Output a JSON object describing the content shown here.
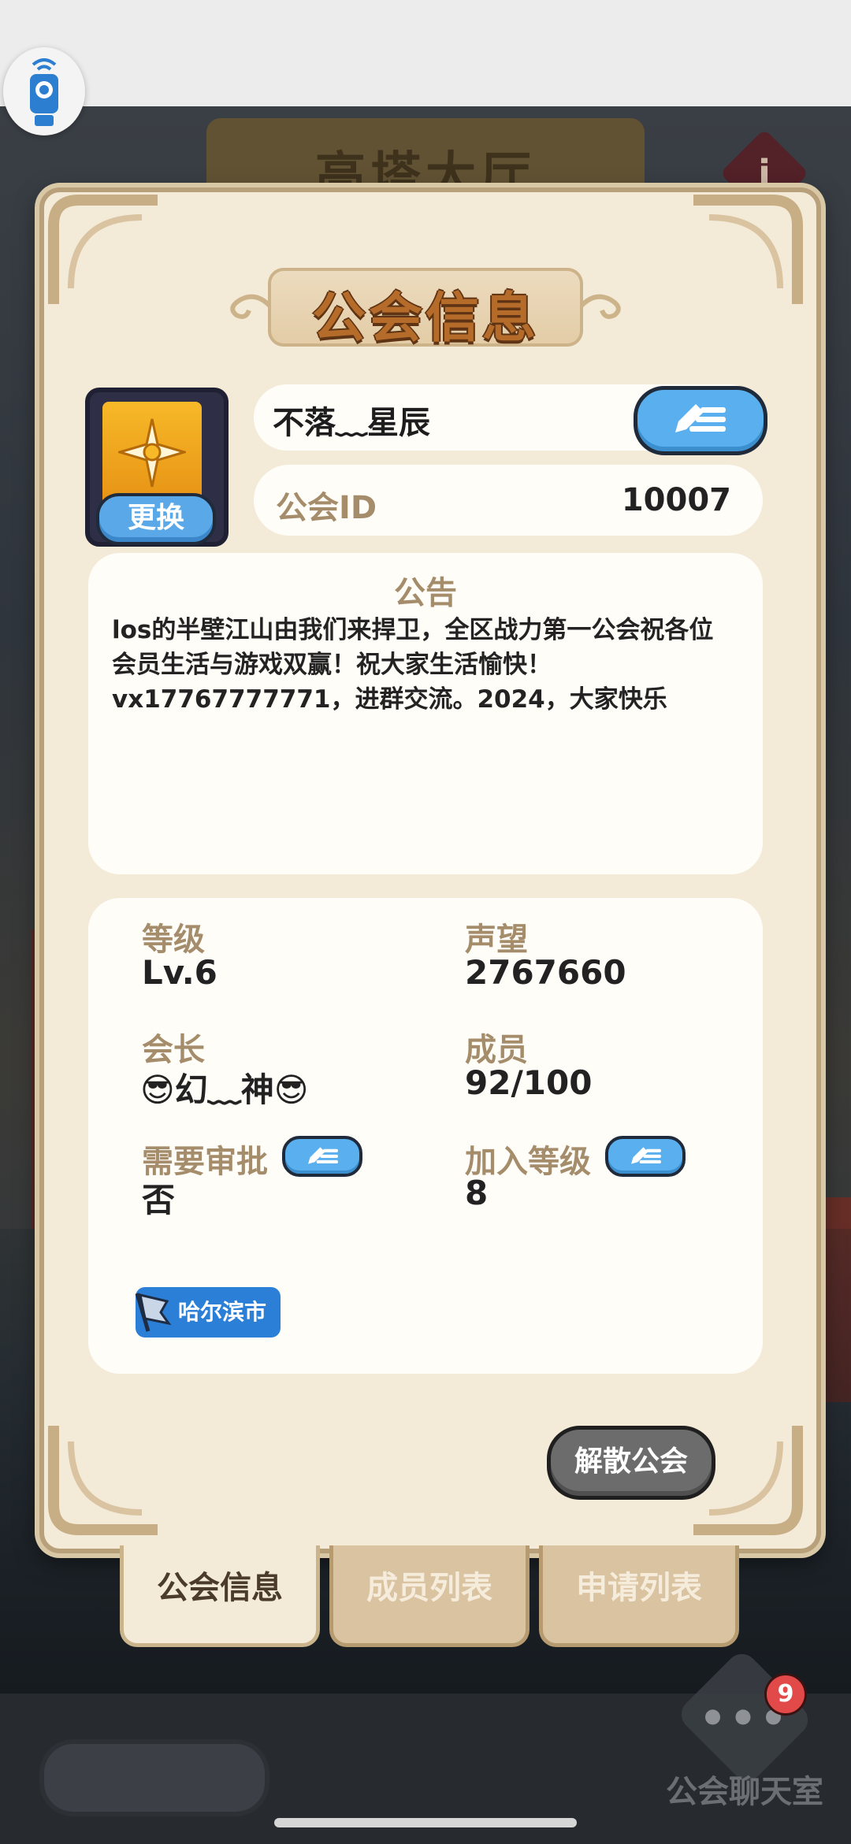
{
  "background": {
    "hall_title": "高塔大厅",
    "info_icon": "i",
    "chat": {
      "badge_count": "9",
      "label": "公会聊天室",
      "dots": "•••"
    }
  },
  "dialog": {
    "title": "公会信息",
    "emblem": {
      "change_label": "更换"
    },
    "guild_name": "不落﹏星辰",
    "guild_id_label": "公会ID",
    "guild_id_value": "10007",
    "notice": {
      "title": "公告",
      "lines": [
        "los的半壁江山由我们来捍卫，全区战力第一公会祝各位",
        "会员生活与游戏双赢！祝大家生活愉快！",
        "vx17767777771，进群交流。2024，大家快乐"
      ]
    },
    "stats": {
      "level_label": "等级",
      "level_value": "Lv.6",
      "prestige_label": "声望",
      "prestige_value": "2767660",
      "leader_label": "会长",
      "leader_value": "😎幻﹏神😎",
      "members_label": "成员",
      "members_value": "92/100",
      "approval_label": "需要审批",
      "approval_value": "否",
      "join_level_label": "加入等级",
      "join_level_value": "8"
    },
    "city_tag": "哈尔滨市",
    "dissolve_button": "解散公会"
  },
  "tabs": [
    {
      "label": "公会信息",
      "active": true
    },
    {
      "label": "成员列表",
      "active": false
    },
    {
      "label": "申请列表",
      "active": false
    }
  ]
}
